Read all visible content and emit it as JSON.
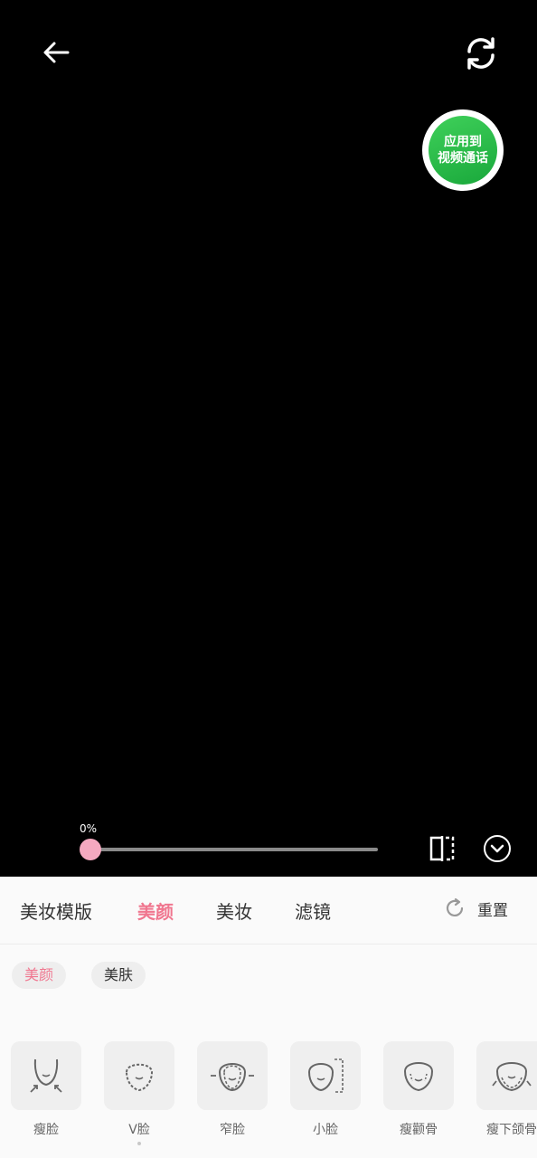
{
  "apply_button": {
    "line1": "应用到",
    "line2": "视频通话"
  },
  "slider": {
    "value_label": "0%",
    "value": 0
  },
  "tabs": [
    {
      "label": "美妆模版",
      "active": false
    },
    {
      "label": "美颜",
      "active": true
    },
    {
      "label": "美妆",
      "active": false
    },
    {
      "label": "滤镜",
      "active": false
    }
  ],
  "reset": {
    "label": "重置"
  },
  "subtabs": [
    {
      "label": "美颜",
      "active": true
    },
    {
      "label": "美肤",
      "active": false
    }
  ],
  "items": [
    {
      "label": "瘦脸",
      "icon": "thin-face-icon"
    },
    {
      "label": "V脸",
      "icon": "v-face-icon"
    },
    {
      "label": "窄脸",
      "icon": "narrow-face-icon"
    },
    {
      "label": "小脸",
      "icon": "small-face-icon"
    },
    {
      "label": "瘦颧骨",
      "icon": "cheekbone-icon"
    },
    {
      "label": "瘦下颌骨",
      "icon": "jawbone-icon"
    }
  ],
  "colors": {
    "accent": "#f0768f",
    "apply_green": "#19a83b",
    "thumb": "#f5a9c0"
  }
}
